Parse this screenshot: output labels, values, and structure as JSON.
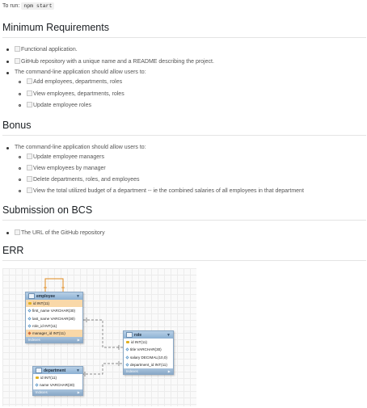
{
  "intro": {
    "label": "To run:",
    "command": "npm start"
  },
  "minimum": {
    "title": "Minimum Requirements",
    "items": [
      "Functional application.",
      "GitHub repository with a unique name and a README describing the project.",
      "The command-line application should allow users to:"
    ],
    "subitems": [
      "Add employees, departments, roles",
      "View employees, departments, roles",
      "Update employee roles"
    ]
  },
  "bonus": {
    "title": "Bonus",
    "intro": "The command-line application should allow users to:",
    "subitems": [
      "Update employee managers",
      "View employees by manager",
      "Delete departments, roles, and employees",
      "View the total utilized budget of a department -- ie the combined salaries of all employees in that department"
    ]
  },
  "submission": {
    "title": "Submission on BCS",
    "items": [
      "The URL of the GitHub repository"
    ]
  },
  "err": {
    "title": "ERR",
    "tables": {
      "employee": {
        "name": "employee",
        "rows": [
          "id INT(11)",
          "first_name VARCHAR(30)",
          "last_name VARCHAR(30)",
          "role_id INT(11)",
          "manager_id INT(11)"
        ],
        "footer": "Indexes"
      },
      "role": {
        "name": "role",
        "rows": [
          "id INT(11)",
          "title VARCHAR(30)",
          "salary DECIMAL(10,0)",
          "department_id INT(11)"
        ],
        "footer": "Indexes"
      },
      "department": {
        "name": "department",
        "rows": [
          "id INT(11)",
          "name VARCHAR(30)"
        ],
        "footer": "Indexes"
      }
    }
  }
}
